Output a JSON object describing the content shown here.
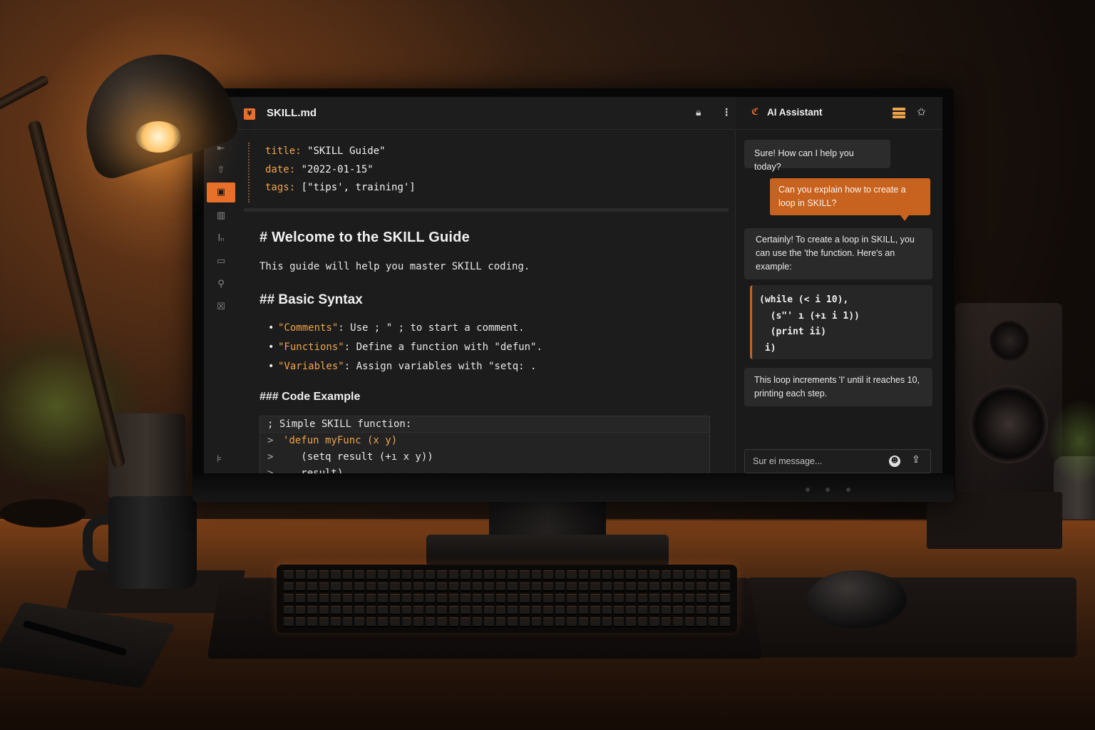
{
  "editor": {
    "file_name": "SKILL.md",
    "file_icon": "markdown-file-icon",
    "header_icons": [
      "lock-icon",
      "more-vertical-icon"
    ],
    "activity_icons": [
      "run-icon",
      "upload-icon",
      "file-active-icon",
      "book-icon",
      "index-icon",
      "layout-icon",
      "pin-icon",
      "checkbox-icon"
    ],
    "frontmatter": [
      {
        "key": "title:",
        "value": "\"SKILL Guide\""
      },
      {
        "key": "date:",
        "value": "\"2022-01-15\""
      },
      {
        "key": "tags:",
        "value": "[\"tips', training']"
      }
    ],
    "h1": "# Welcome to the SKILL Guide",
    "intro": "This guide will help you master SKILL coding.",
    "h2": "## Basic Syntax",
    "bullets": [
      {
        "term": "\"Comments\"",
        "text": ": Use ; \" ; to start a comment."
      },
      {
        "term": "\"Functions\"",
        "text": ": Define a function with \"defun\"."
      },
      {
        "term": "\"Variables\"",
        "text": ": Assign variables with \"setq: ."
      }
    ],
    "h3": "### Code Example",
    "code": [
      {
        "gutter": "",
        "text": "; Simple SKILL function:"
      },
      {
        "gutter": ">",
        "text": "'defun myFunc (x y)"
      },
      {
        "gutter": ">",
        "text": "   (setq result (+ı x y))"
      },
      {
        "gutter": ">",
        "text": "   result)"
      }
    ]
  },
  "assistant": {
    "title": "AI Assistant",
    "messages": {
      "greeting": "Sure! How can I help you today?",
      "user_question": "Can you explain how to create a loop in SKILL?",
      "answer": "Certainly! To create a loop in SKILL, you can use the 'the function. Here's an example:",
      "code": "(while (< i 10),\n  (s\"' ı (+ı i 1))\n  (print ii)\n i)",
      "explanation": "This loop increments 'I' until it reaches 10, printing each step."
    },
    "input_placeholder": "Sur ei message..."
  },
  "colors": {
    "accent": "#e8702a",
    "user_bubble": "#c8621f",
    "keyword": "#f0a44a",
    "background": "#1c1c1d"
  }
}
